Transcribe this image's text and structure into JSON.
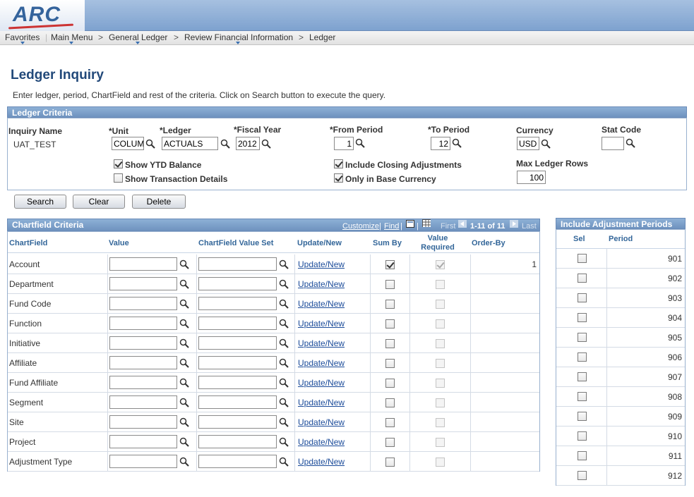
{
  "header": {
    "logo_text": "ARC"
  },
  "nav": {
    "items": [
      "Favorites",
      "Main Menu",
      "General Ledger",
      "Review Financial Information",
      "Ledger"
    ],
    "separator": ">"
  },
  "page": {
    "title": "Ledger Inquiry",
    "instructions": "Enter ledger, period, ChartField and rest of the criteria. Click on Search button to execute the query."
  },
  "criteria": {
    "section_title": "Ledger Criteria",
    "inquiry_name_label": "Inquiry Name",
    "inquiry_name_value": "UAT_TEST",
    "unit_label": "*Unit",
    "unit_value": "COLUM",
    "ledger_label": "*Ledger",
    "ledger_value": "ACTUALS",
    "fiscal_year_label": "*Fiscal Year",
    "fiscal_year_value": "2012",
    "from_period_label": "*From Period",
    "from_period_value": "1",
    "to_period_label": "*To Period",
    "to_period_value": "12",
    "currency_label": "Currency",
    "currency_value": "USD",
    "stat_code_label": "Stat Code",
    "stat_code_value": "",
    "show_ytd_label": "Show YTD Balance",
    "show_ytd_checked": true,
    "show_txn_label": "Show Transaction Details",
    "show_txn_checked": false,
    "include_closing_label": "Include Closing Adjustments",
    "include_closing_checked": true,
    "only_base_label": "Only in Base Currency",
    "only_base_checked": true,
    "max_rows_label": "Max Ledger Rows",
    "max_rows_value": "100"
  },
  "buttons": {
    "search": "Search",
    "clear": "Clear",
    "delete": "Delete"
  },
  "chartfield": {
    "section_title": "Chartfield Criteria",
    "toolbar": {
      "customize": "Customize",
      "find": "Find",
      "first": "First",
      "range": "1-11 of 11",
      "last": "Last"
    },
    "columns": [
      "ChartField",
      "Value",
      "ChartField Value Set",
      "Update/New",
      "Sum By",
      "Value Required",
      "Order-By"
    ],
    "update_link": "Update/New",
    "rows": [
      {
        "name": "Account",
        "sum_by": true,
        "required": true,
        "order_by": "1"
      },
      {
        "name": "Department",
        "sum_by": false,
        "required": false,
        "order_by": ""
      },
      {
        "name": "Fund Code",
        "sum_by": false,
        "required": false,
        "order_by": ""
      },
      {
        "name": "Function",
        "sum_by": false,
        "required": false,
        "order_by": ""
      },
      {
        "name": "Initiative",
        "sum_by": false,
        "required": false,
        "order_by": ""
      },
      {
        "name": "Affiliate",
        "sum_by": false,
        "required": false,
        "order_by": ""
      },
      {
        "name": "Fund Affiliate",
        "sum_by": false,
        "required": false,
        "order_by": ""
      },
      {
        "name": "Segment",
        "sum_by": false,
        "required": false,
        "order_by": ""
      },
      {
        "name": "Site",
        "sum_by": false,
        "required": false,
        "order_by": ""
      },
      {
        "name": "Project",
        "sum_by": false,
        "required": false,
        "order_by": ""
      },
      {
        "name": "Adjustment Type",
        "sum_by": false,
        "required": false,
        "order_by": ""
      }
    ]
  },
  "adjustments": {
    "section_title": "Include Adjustment Periods",
    "columns": [
      "Sel",
      "Period"
    ],
    "periods": [
      "901",
      "902",
      "903",
      "904",
      "905",
      "906",
      "907",
      "908",
      "909",
      "910",
      "911",
      "912"
    ]
  }
}
